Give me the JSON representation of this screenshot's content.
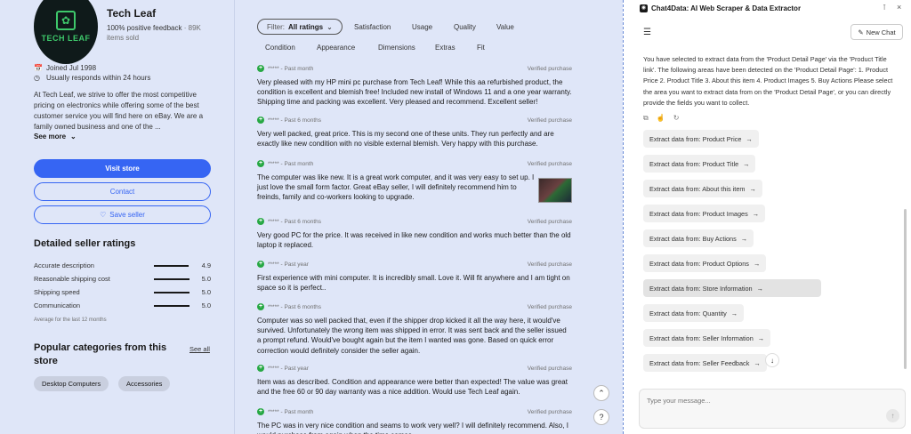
{
  "seller": {
    "logo_text": "TECH LEAF",
    "name": "Tech Leaf",
    "positive_feedback": "100% positive feedback",
    "feedback_count": "· 89K",
    "items_sold": "items sold",
    "joined": "Joined Jul 1998",
    "response": "Usually responds within 24 hours",
    "about": "At Tech Leaf, we strive to offer the most competitive pricing on electronics while offering some of the best customer service you will find here on eBay. We are a family owned business and one of the ...",
    "see_more": "See more",
    "visit_store": "Visit store",
    "contact": "Contact",
    "save_seller": "Save seller"
  },
  "ratings": {
    "title": "Detailed seller ratings",
    "items": [
      {
        "label": "Accurate description",
        "value": "4.9",
        "fill": 0.98
      },
      {
        "label": "Reasonable shipping cost",
        "value": "5.0",
        "fill": 1.0
      },
      {
        "label": "Shipping speed",
        "value": "5.0",
        "fill": 1.0
      },
      {
        "label": "Communication",
        "value": "5.0",
        "fill": 1.0
      }
    ],
    "note": "Average for the last 12 months"
  },
  "popular": {
    "title": "Popular categories from this store",
    "see_all": "See all",
    "chips": [
      "Desktop Computers",
      "Accessories"
    ]
  },
  "filters": {
    "pill_prefix": "Filter:",
    "pill_value": "All ratings",
    "tabs": [
      "Satisfaction",
      "Usage",
      "Quality",
      "Value",
      "Condition",
      "Appearance",
      "Dimensions",
      "Extras",
      "Fit"
    ]
  },
  "reviews": [
    {
      "stars": "*****",
      "period": "- Past month",
      "verified": "Verified purchase",
      "text": "Very pleased with my HP mini pc purchase from Tech Leaf! While this aа refurbished product, the condition is excellent and blemish free! Included new install of Windows 11 and a one year warranty. Shipping time and packing was excellent. Very pleased and recommend. Excellent seller!"
    },
    {
      "stars": "*****",
      "period": "- Past 6 months",
      "verified": "Verified purchase",
      "text": "Very well packed, great price. This is my second one of these units. They run perfectly and are exactly like new condition with no visible external blemish. Very happy with this purchase."
    },
    {
      "stars": "*****",
      "period": "- Past month",
      "verified": "Verified purchase",
      "text": "The computer was like new. It is a great work computer, and it was very easy to set up. I just love the small form factor. Great eBay seller, I will definitely recommend him to freinds, family and co-workers looking to upgrade."
    },
    {
      "stars": "*****",
      "period": "- Past 6 months",
      "verified": "Verified purchase",
      "text": "Very good PC for the price. It was received in like new condition and works much better than the old laptop it replaced."
    },
    {
      "stars": "*****",
      "period": "- Past year",
      "verified": "Verified purchase",
      "text": "First experience with mini computer. It is incredibly small. Love it. Will fit anywhere and I am tight on space so it is perfect.."
    },
    {
      "stars": "*****",
      "period": "- Past 6 months",
      "verified": "Verified purchase",
      "text": "Computer was so well packed that, even if the shipper drop kicked it all the way here, it would've survived. Unfortunately the wrong item was shipped in error. It was sent back and the seller issued a prompt refund. Would've bought again but the item I wanted was gone. Based on quick error correction would definitely consider the seller again."
    },
    {
      "stars": "*****",
      "period": "- Past year",
      "verified": "Verified purchase",
      "text": "Item was as described. Condition and appearance were better than expected! The value was great and the free 60 or 90 day warranty was a nice addition. Would use Tech Leaf again."
    },
    {
      "stars": "*****",
      "period": "- Past month",
      "verified": "Verified purchase",
      "text": "The PC was in very nice condition and seams to work very well? I will definitely recommend. Also, I would purchase from again when the time comes."
    }
  ],
  "assistant": {
    "title": "Chat4Data: AI Web Scraper & Data Extractor",
    "new_chat": "New Chat",
    "message": "You have selected to extract data from the 'Product Detail Page' via the 'Product Title link'. The following areas have been detected on the 'Product Detail Page': 1. Product Price 2. Product Title 3. About this item 4. Product Images 5. Buy Actions Please select the area you want to extract data from on the 'Product Detail Page', or you can directly provide the fields you want to collect.",
    "options": [
      "Extract data from: Product Price",
      "Extract data from: Product Title",
      "Extract data from: About this item",
      "Extract data from: Product Images",
      "Extract data from: Buy Actions",
      "Extract data from: Product Options",
      "Extract data from: Store Information",
      "Extract data from: Quantity",
      "Extract data from: Seller Information",
      "Extract data from: Seller Feedback"
    ],
    "input_placeholder": "Type your message..."
  }
}
